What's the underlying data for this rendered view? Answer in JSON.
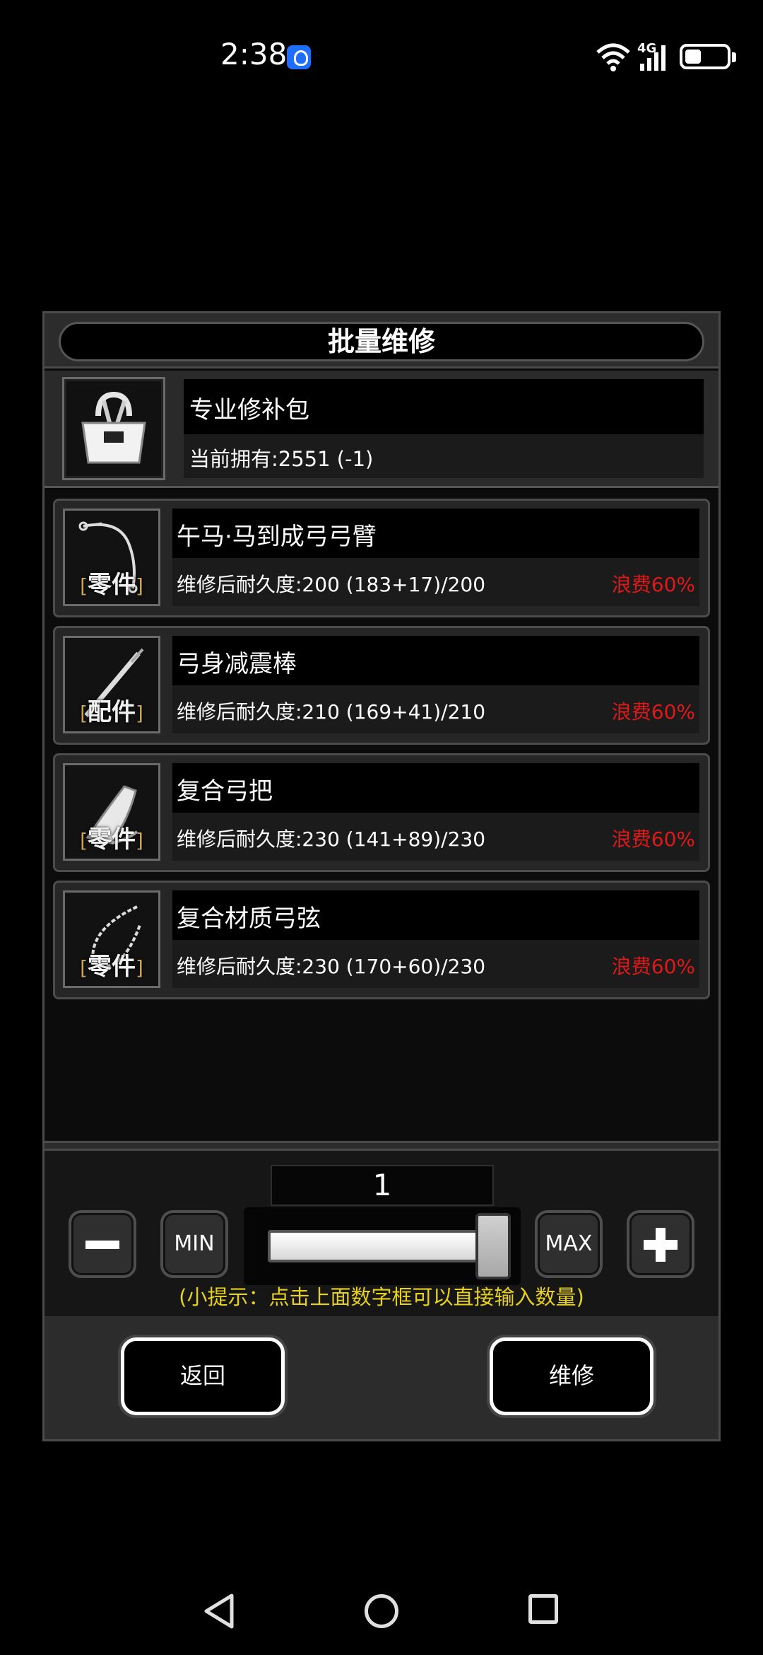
{
  "status": {
    "time": "2:38",
    "network": "4G"
  },
  "dialog": {
    "title": "批量维修",
    "kit": {
      "name": "专业修补包",
      "owned": "当前拥有:2551 (-1)"
    },
    "items": [
      {
        "name": "午马·马到成弓弓臂",
        "tag": "零件",
        "durability": "维修后耐久度:200 (183+17)/200",
        "waste": "浪费60%"
      },
      {
        "name": "弓身减震棒",
        "tag": "配件",
        "durability": "维修后耐久度:210 (169+41)/210",
        "waste": "浪费60%"
      },
      {
        "name": "复合弓把",
        "tag": "零件",
        "durability": "维修后耐久度:230 (141+89)/230",
        "waste": "浪费60%"
      },
      {
        "name": "复合材质弓弦",
        "tag": "零件",
        "durability": "维修后耐久度:230 (170+60)/230",
        "waste": "浪费60%"
      }
    ],
    "quantity": {
      "value": "1",
      "min_label": "MIN",
      "max_label": "MAX",
      "slider_fraction": 1.0,
      "hint": "(小提示：点击上面数字框可以直接输入数量)"
    },
    "buttons": {
      "back": "返回",
      "repair": "维修"
    }
  },
  "colors": {
    "waste_text": "#e01818",
    "hint_text": "#e8d11a",
    "tag_bracket": "#c9a45a"
  }
}
